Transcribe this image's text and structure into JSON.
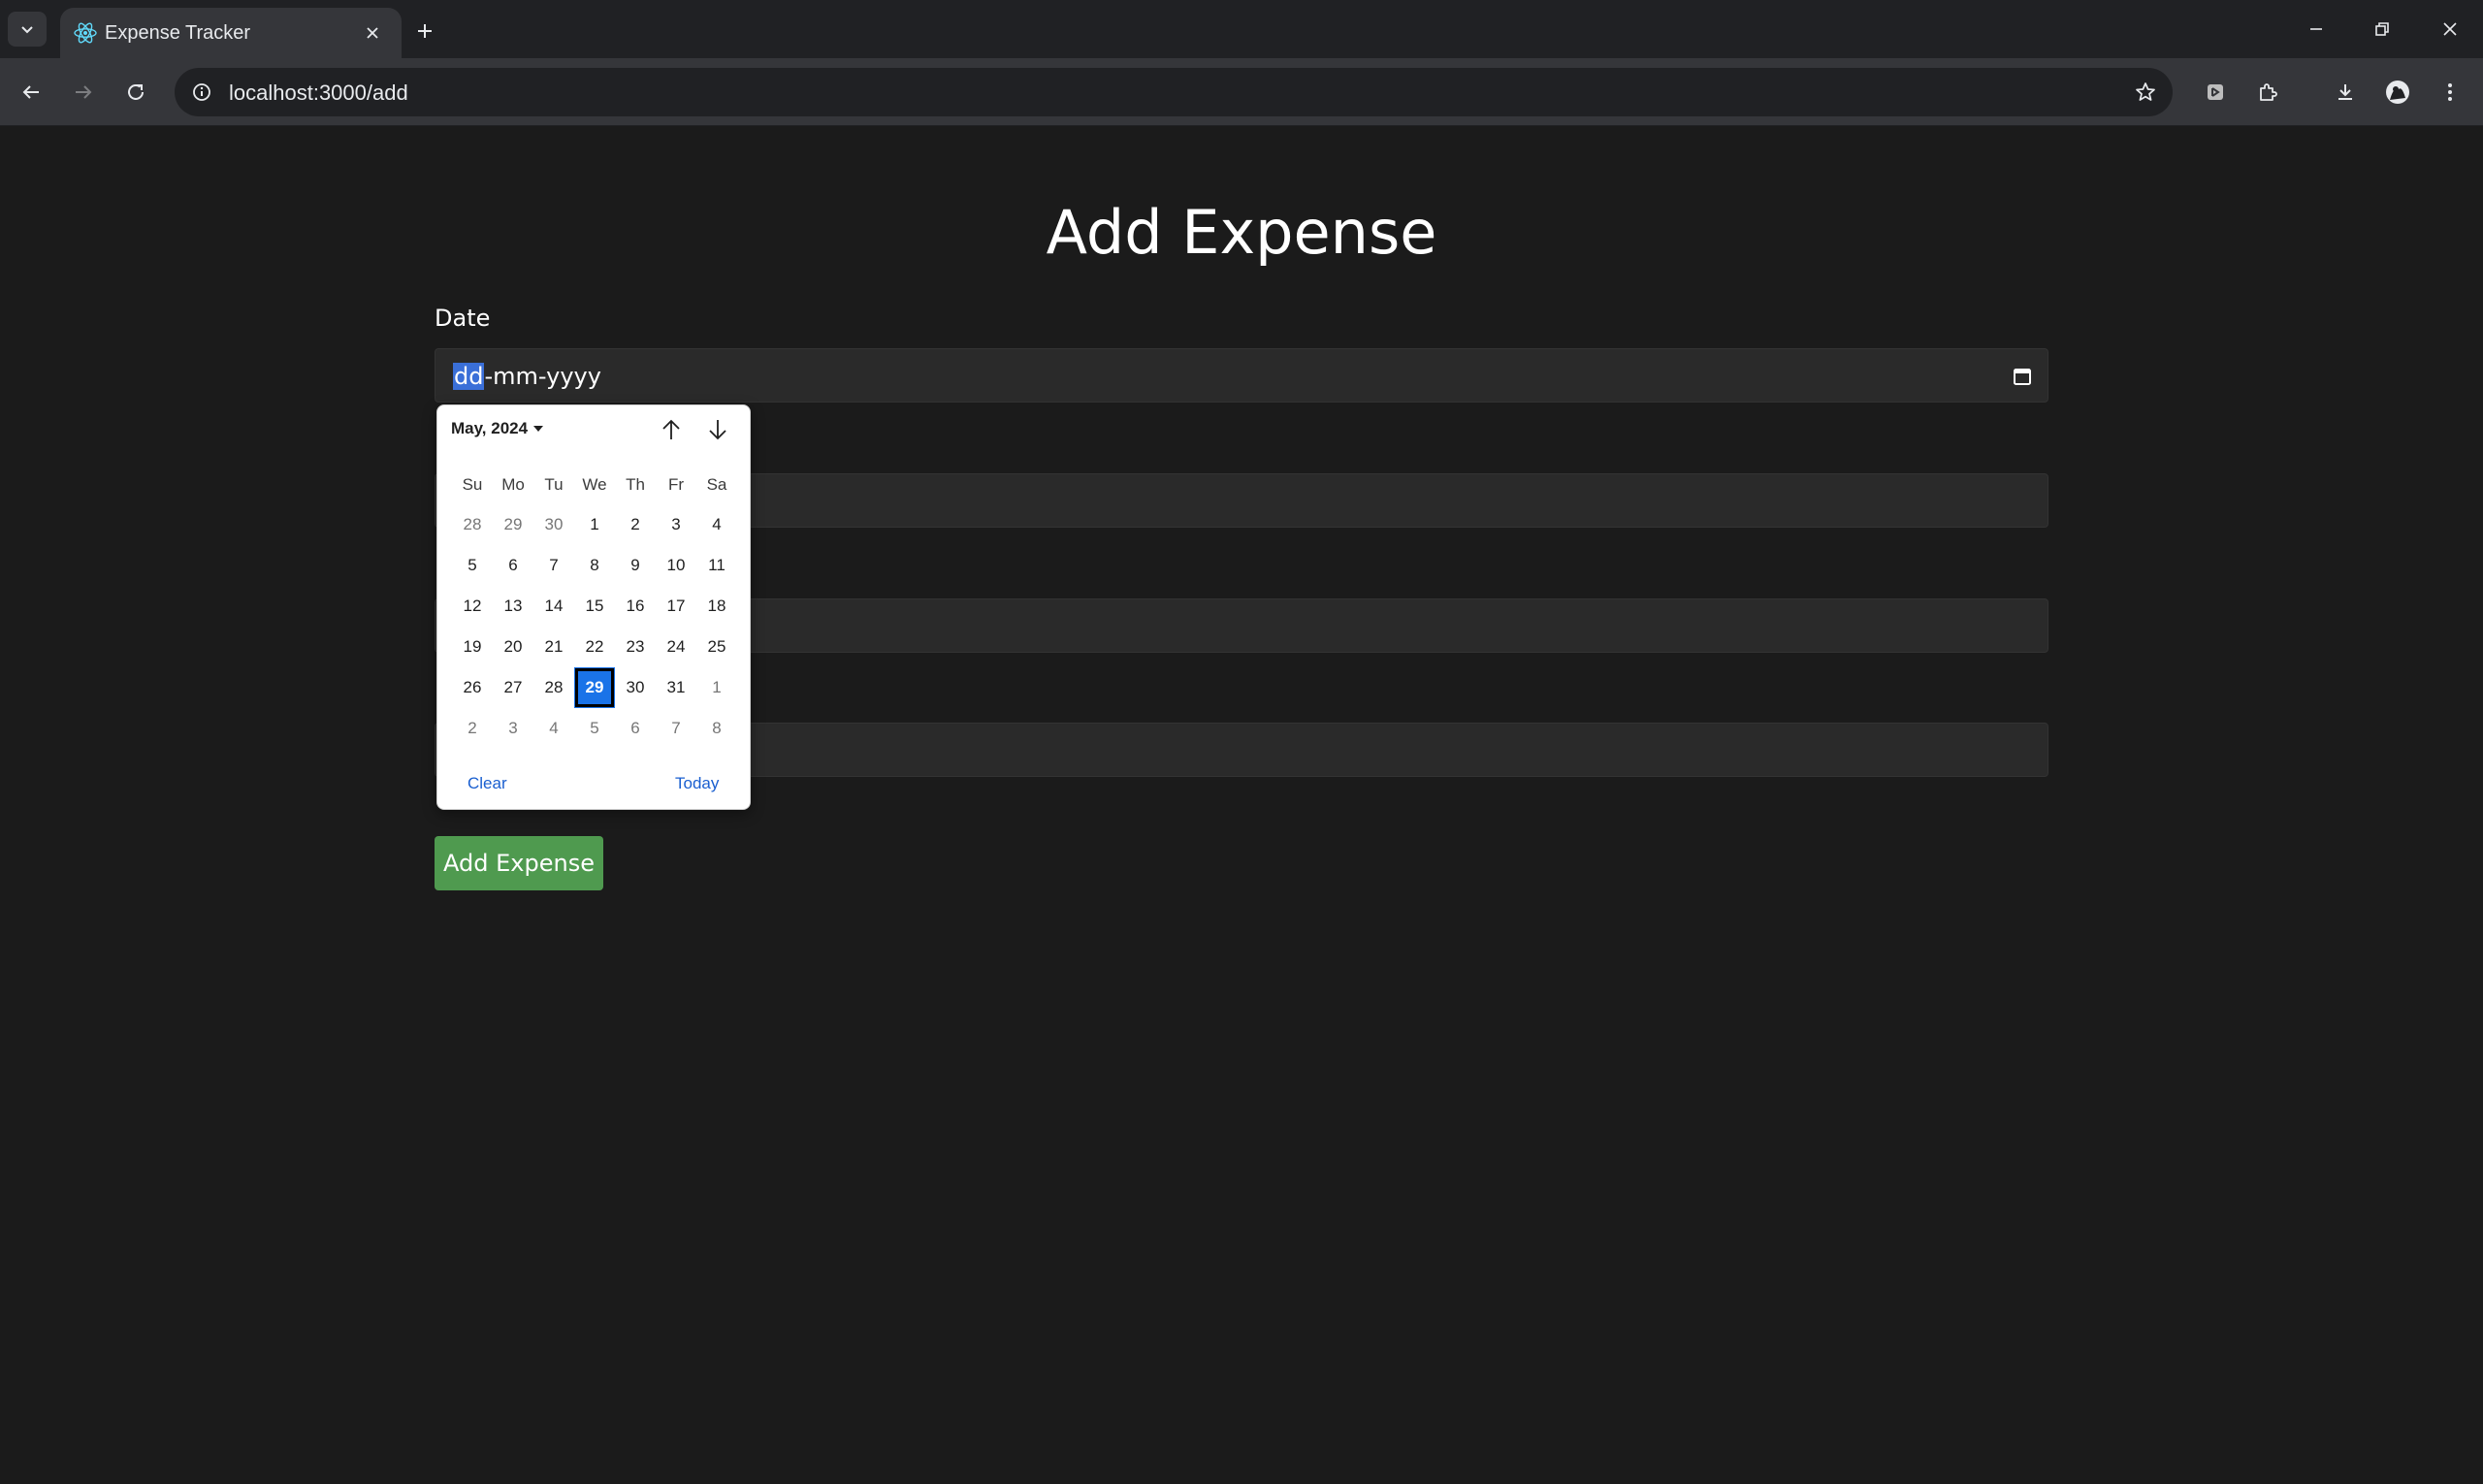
{
  "browser": {
    "tab_title": "Expense Tracker",
    "url": "localhost:3000/add"
  },
  "page": {
    "title": "Add Expense",
    "date_label": "Date",
    "date_placeholder_selected": "dd",
    "date_placeholder_rest": "-mm-yyyy",
    "submit_label": "Add Expense"
  },
  "datepicker": {
    "month_label": "May, 2024",
    "weekdays": [
      "Su",
      "Mo",
      "Tu",
      "We",
      "Th",
      "Fr",
      "Sa"
    ],
    "days": [
      {
        "d": "28",
        "other": true
      },
      {
        "d": "29",
        "other": true
      },
      {
        "d": "30",
        "other": true
      },
      {
        "d": "1"
      },
      {
        "d": "2"
      },
      {
        "d": "3"
      },
      {
        "d": "4"
      },
      {
        "d": "5"
      },
      {
        "d": "6"
      },
      {
        "d": "7"
      },
      {
        "d": "8"
      },
      {
        "d": "9"
      },
      {
        "d": "10"
      },
      {
        "d": "11"
      },
      {
        "d": "12"
      },
      {
        "d": "13"
      },
      {
        "d": "14"
      },
      {
        "d": "15"
      },
      {
        "d": "16"
      },
      {
        "d": "17"
      },
      {
        "d": "18"
      },
      {
        "d": "19"
      },
      {
        "d": "20"
      },
      {
        "d": "21"
      },
      {
        "d": "22"
      },
      {
        "d": "23"
      },
      {
        "d": "24"
      },
      {
        "d": "25"
      },
      {
        "d": "26"
      },
      {
        "d": "27"
      },
      {
        "d": "28"
      },
      {
        "d": "29",
        "selected": true
      },
      {
        "d": "30"
      },
      {
        "d": "31"
      },
      {
        "d": "1",
        "other": true
      },
      {
        "d": "2",
        "other": true
      },
      {
        "d": "3",
        "other": true
      },
      {
        "d": "4",
        "other": true
      },
      {
        "d": "5",
        "other": true
      },
      {
        "d": "6",
        "other": true
      },
      {
        "d": "7",
        "other": true
      },
      {
        "d": "8",
        "other": true
      }
    ],
    "clear_label": "Clear",
    "today_label": "Today"
  },
  "colors": {
    "page_bg": "#1b1b1b",
    "submit_green": "#4f9a4f",
    "selected_day": "#1a73e8",
    "link_blue": "#1a5fd0"
  }
}
